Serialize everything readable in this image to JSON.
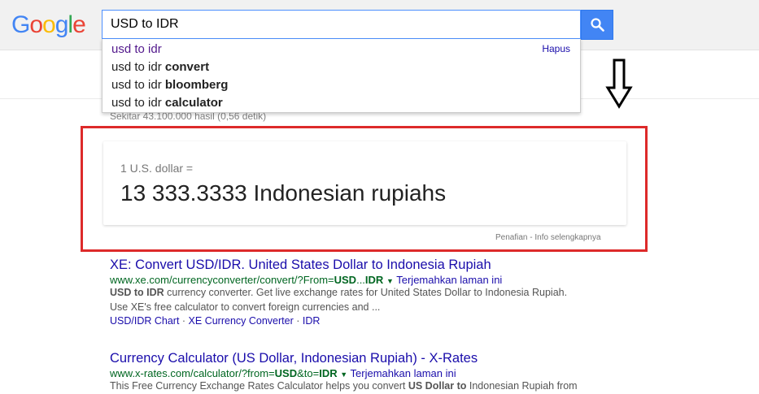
{
  "logo": {
    "text": "Google",
    "letters": [
      "G",
      "o",
      "o",
      "g",
      "l",
      "e"
    ],
    "colors": [
      "#4285f4",
      "#ea4335",
      "#fbbc05",
      "#4285f4",
      "#34a853",
      "#ea4335"
    ]
  },
  "search": {
    "value": "USD to IDR",
    "button_icon": "search-icon"
  },
  "suggestions": {
    "delete_label": "Hapus",
    "items": [
      {
        "plain": "usd to idr",
        "bold": ""
      },
      {
        "plain": "usd to idr ",
        "bold": "convert"
      },
      {
        "plain": "usd to idr ",
        "bold": "bloomberg"
      },
      {
        "plain": "usd to idr ",
        "bold": "calculator"
      }
    ]
  },
  "result_stats": "Sekitar 43.100.000 hasil (0,56 detik)",
  "converter": {
    "from_text": "1 U.S. dollar =",
    "to_text": "13 333.3333 Indonesian rupiahs",
    "disclaimer": "Penafian",
    "sep": " - ",
    "more_info": "Info selengkapnya"
  },
  "annotation": {
    "arrow_icon": "down-arrow-icon",
    "highlight_color": "#dd2a2a"
  },
  "results": [
    {
      "title": "XE: Convert USD/IDR. United States Dollar to Indonesia Rupiah",
      "url_parts": [
        "www.xe.com/currencyconverter/convert/?From=",
        "USD",
        "...",
        "IDR"
      ],
      "translate": "Terjemahkan laman ini",
      "snippet_line1_bold": "USD to IDR",
      "snippet_line1": " currency converter. Get live exchange rates for United States Dollar to Indonesia Rupiah.",
      "snippet_line2": "Use XE's free calculator to convert foreign currencies and ...",
      "sitelinks": [
        "USD/IDR Chart",
        "XE Currency Converter",
        "IDR"
      ],
      "sitelink_sep": " · "
    },
    {
      "title": "Currency Calculator (US Dollar, Indonesian Rupiah) - X-Rates",
      "url_parts": [
        "www.x-rates.com/calculator/?from=",
        "USD",
        "&to=",
        "IDR"
      ],
      "translate": "Terjemahkan laman ini",
      "snippet_a": "This Free Currency Exchange Rates Calculator helps you convert ",
      "snippet_b": "US Dollar to",
      "snippet_c": " Indonesian Rupiah from"
    }
  ]
}
